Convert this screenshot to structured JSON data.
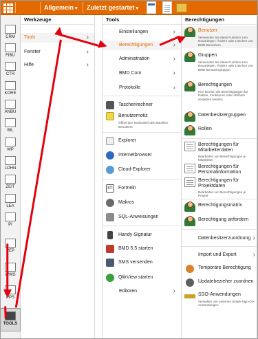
{
  "topbar": {
    "menu_allgemein": "Allgemein",
    "menu_zuletzt": "Zuletzt gestartet",
    "accent": "#e26a00"
  },
  "leftbar": {
    "items": [
      {
        "label": "CRM",
        "icon": "crm-icon"
      },
      {
        "label": "FIBU",
        "icon": "fibu-icon"
      },
      {
        "label": "CTR",
        "icon": "ctr-icon"
      },
      {
        "label": "KORE",
        "icon": "kore-icon"
      },
      {
        "label": "ANBU",
        "icon": "anbu-icon"
      },
      {
        "label": "BIL",
        "icon": "bil-icon"
      },
      {
        "label": "WP",
        "icon": "wp-icon"
      },
      {
        "label": "LOHN",
        "icon": "lohn-icon"
      },
      {
        "label": "ZEIT",
        "icon": "zeit-icon"
      },
      {
        "label": "LEA",
        "icon": "lea-icon"
      },
      {
        "label": "PI",
        "icon": "pi-icon"
      },
      {
        "label": "PEP",
        "icon": "pep-icon"
      },
      {
        "label": "WWS",
        "icon": "wws-icon"
      },
      {
        "label": "PPS",
        "icon": "pps-icon"
      },
      {
        "label": "TOOLS",
        "icon": "tools-icon"
      }
    ]
  },
  "werkzeuge": {
    "title": "Werkzeuge",
    "items": [
      "Tools",
      "Fenster",
      "Hilfe"
    ]
  },
  "tools": {
    "title": "Tools",
    "submenus": [
      "Einstellungen",
      "Berechtigungen",
      "Administration",
      "BMD Com",
      "Protokolle"
    ],
    "taschenrechner": "Taschenrechner",
    "benutzernotiz": "Benutzernotiz",
    "benutzernotiz_sub": "Öffnet den Notizzettel des aktuellen Benutzers",
    "explorer": "Explorer",
    "internetbrowser": "Internetbrowser",
    "cloud_explorer": "Cloud-Explorer",
    "formeln": "Formeln",
    "makros": "Makros",
    "sql": "SQL-Anweisungen",
    "handy_signatur": "Handy-Signatur",
    "bmd55": "BMD 5.5 starten",
    "sms": "SMS versenden",
    "qlikview": "QlikView starten",
    "editoren": "Editoren"
  },
  "berechtigungen": {
    "title": "Berechtigungen",
    "benutzer": "Benutzer",
    "benutzer_sub": "Verwenden Sie diese Funktion zum Neuanlegen, Ändern oder Löschen von BMD-Benutzern.",
    "gruppen": "Gruppen",
    "gruppen_sub": "Verwenden Sie diese Funktion zum Neuanlegen, Ändern oder Löschen von BMD-Benutzergruppen.",
    "berechtigungen": "Berechtigungen",
    "berechtigungen_sub": "Hier können die Berechtigungen für Pakete, Funktionen oder Attribute vergeben werden.",
    "datenbesitzergruppen": "Datenbesitzergruppen",
    "rollen": "Rollen",
    "mitarbeiterdaten": "Berechtigungen für Mitarbeiterdaten",
    "mitarbeiterdaten_sub": "Bearbeiten von Berechtigungen je Mitarbeiter",
    "personalinformation": "Berechtigungen für Personalinformation",
    "projektdaten": "Berechtigungen für Projektdaten",
    "projektdaten_sub": "Bearbeiten von Berechtigungen je Projekt",
    "matrix": "Berechtigungsmatrix",
    "anfordern": "Berechtigung anfordern",
    "datenbesitzerzuordnung": "Datenbesitzerzuordnung",
    "import_export": "Import und Export",
    "temporaere": "Temporäre Berechtigung",
    "updatebezieher": "Updatebezieher zuordnen",
    "sso": "SSO-Anwendungen",
    "sso_sub": "Verwalten von externen Single-Sign-On-Anwendungen"
  }
}
